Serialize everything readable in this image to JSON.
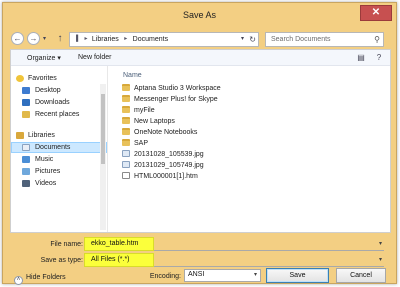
{
  "window": {
    "title": "Save As",
    "close_glyph": "✕"
  },
  "nav": {
    "back_glyph": "←",
    "forward_glyph": "→",
    "recent_glyph": "▾",
    "up_glyph": "↑",
    "breadcrumb": {
      "root_glyph": "▐",
      "sep": "▸",
      "part1": "Libraries",
      "part2": "Documents"
    },
    "address_dropdown_glyph": "▾",
    "refresh_glyph": "↻",
    "search_placeholder": "Search Documents",
    "search_glyph": "⚲"
  },
  "commandbar": {
    "organize_label": "Organize ▾",
    "new_folder_label": "New folder",
    "view_glyph": "▤",
    "help_glyph": "?"
  },
  "nav_tree": {
    "favorites_header": "Favorites",
    "favorites": [
      "Desktop",
      "Downloads",
      "Recent places"
    ],
    "libraries_header": "Libraries",
    "libraries": [
      "Documents",
      "Music",
      "Pictures",
      "Videos"
    ],
    "selected": "Documents"
  },
  "file_list": {
    "column_name": "Name",
    "items": [
      {
        "name": "Aptana Studio 3 Workspace",
        "type": "folder"
      },
      {
        "name": "Messenger Plus! for Skype",
        "type": "folder"
      },
      {
        "name": "myFile",
        "type": "folder"
      },
      {
        "name": "New Laptops",
        "type": "folder"
      },
      {
        "name": "OneNote Notebooks",
        "type": "folder"
      },
      {
        "name": "SAP",
        "type": "folder"
      },
      {
        "name": "20131028_105539.jpg",
        "type": "image"
      },
      {
        "name": "20131029_105749.jpg",
        "type": "image"
      },
      {
        "name": "HTML000001[1].htm",
        "type": "htm"
      }
    ]
  },
  "form": {
    "file_name_label": "File name:",
    "file_name_value": "ekko_table.htm",
    "save_type_label": "Save as type:",
    "save_type_value": "All Files  (*.*)",
    "dropdown_glyph": "▾"
  },
  "footer": {
    "hide_folders_label": "Hide Folders",
    "hide_folders_glyph": "˄",
    "encoding_label": "Encoding:",
    "encoding_value": "ANSI",
    "save_label": "Save",
    "cancel_label": "Cancel"
  },
  "colors": {
    "frame": "#f3cf83",
    "highlight": "#fbff3b",
    "selection": "#cce8ff",
    "close_button": "#c75050"
  }
}
